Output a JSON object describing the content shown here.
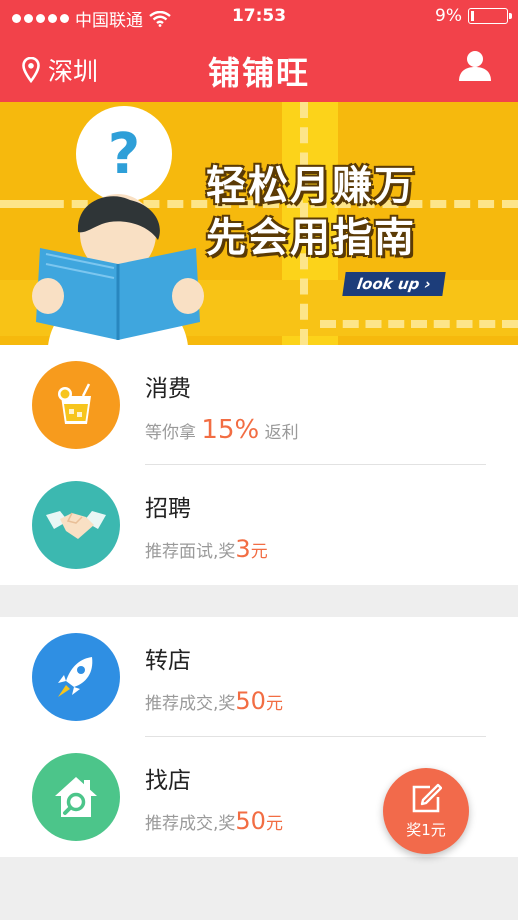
{
  "status_bar": {
    "carrier": "中国联通",
    "time": "17:53",
    "battery": "9%",
    "battery_level": 0.09
  },
  "header": {
    "city": "深圳",
    "title": "铺铺旺"
  },
  "banner": {
    "question_mark": "?",
    "slogan_line1": "轻松月赚万",
    "slogan_line2": "先会用指南",
    "button": "look up"
  },
  "items": [
    {
      "name": "消费",
      "desc_prefix": "等你拿 ",
      "highlight": "15%",
      "desc_suffix": " 返利",
      "icon": "juice-icon",
      "color": "#f79b1d"
    },
    {
      "name": "招聘",
      "desc_prefix": "推荐面试,奖",
      "highlight": "3",
      "desc_suffix": "元",
      "icon": "handshake-icon",
      "color": "#3cb8b0"
    },
    {
      "name": "转店",
      "desc_prefix": "推荐成交,奖",
      "highlight": "50",
      "desc_suffix": "元",
      "icon": "rocket-icon",
      "color": "#2f8fe3"
    },
    {
      "name": "找店",
      "desc_prefix": "推荐成交,奖",
      "highlight": "50",
      "desc_suffix": "元",
      "icon": "house-search-icon",
      "color": "#4cc58a"
    }
  ],
  "fab": {
    "label": "奖1元",
    "icon": "edit-icon"
  }
}
